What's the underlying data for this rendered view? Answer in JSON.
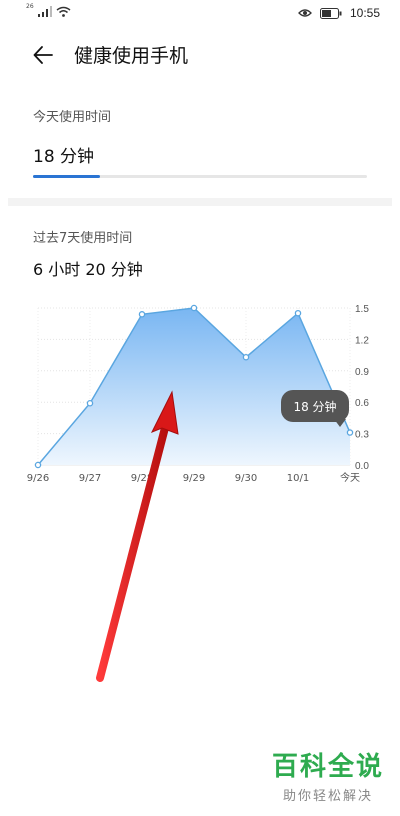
{
  "status_bar": {
    "network_tag": "26",
    "time": "10:55",
    "icons": [
      "signal-icon",
      "wifi-icon",
      "eye-comfort-icon",
      "battery-icon"
    ]
  },
  "header": {
    "back_icon": "arrow-left-icon",
    "title": "健康使用手机"
  },
  "today": {
    "label": "今天使用时间",
    "value": "18 分钟",
    "progress_fraction": 0.2
  },
  "week": {
    "label": "过去7天使用时间",
    "total": "6 小时 20 分钟"
  },
  "tooltip": {
    "text": "18 分钟"
  },
  "chart_data": {
    "type": "area",
    "categories": [
      "9/26",
      "9/27",
      "9/28",
      "9/29",
      "9/30",
      "10/1",
      "今天"
    ],
    "values": [
      0.0,
      0.59,
      1.44,
      1.5,
      1.03,
      1.45,
      0.31
    ],
    "y_ticks": [
      "0.0",
      "0.3",
      "0.6",
      "0.9",
      "1.2",
      "1.5"
    ],
    "ylim": [
      0,
      1.5
    ],
    "y_axis_position": "right",
    "grid": true,
    "line_color": "#5aa6e0",
    "fill_color_top": "#79b6f2",
    "fill_color_bottom": "#eef6fe"
  },
  "overlay": {
    "arrow_color": "#e01b1b"
  },
  "watermark": {
    "title": "百科全说",
    "subtitle": "助你轻松解决"
  }
}
